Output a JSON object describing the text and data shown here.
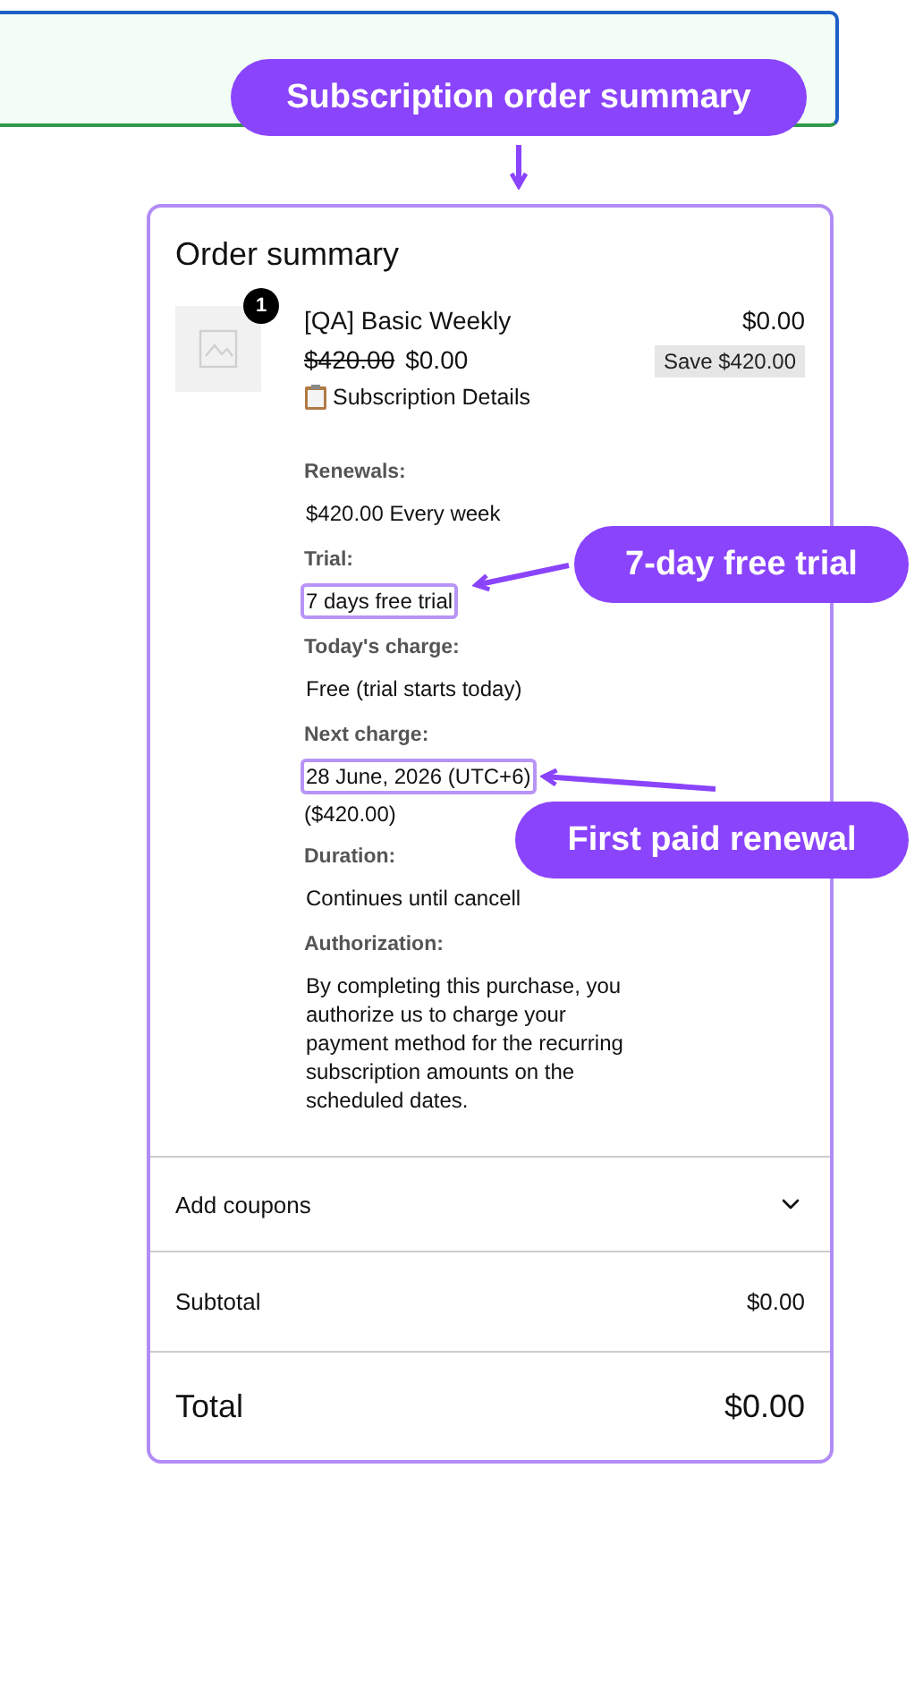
{
  "order_summary": {
    "title": "Order summary",
    "item": {
      "quantity": "1",
      "name": "[QA] Basic Weekly",
      "price": "$0.00",
      "original_price": "$420.00",
      "sale_price": "$0.00",
      "savings": "Save $420.00",
      "details_label": "Subscription Details"
    },
    "details": [
      {
        "label": "Renewals:",
        "value": "$420.00 Every week",
        "highlighted": false
      },
      {
        "label": "Trial:",
        "value": "7 days free trial",
        "highlighted": true
      },
      {
        "label": "Today's charge:",
        "value": "Free (trial starts today)",
        "highlighted": false
      },
      {
        "label": "Next charge:",
        "value": "28 June, 2026 (UTC+6)",
        "note": "($420.00)",
        "highlighted": true
      },
      {
        "label": "Duration:",
        "value": "Continues until cancell",
        "highlighted": false
      },
      {
        "label": "Authorization:",
        "highlighted": false,
        "value": "By completing this purchase, you authorize us to charge your payment method for the recurring subscription amounts on the scheduled dates."
      }
    ],
    "coupons": {
      "label": "Add coupons",
      "expanded": false
    },
    "subtotal": {
      "label": "Subtotal",
      "value": "$0.00"
    },
    "total": {
      "label": "Total",
      "value": "$0.00"
    }
  },
  "annotations": [
    {
      "text": "Subscription order summary"
    },
    {
      "text": "7-day free trial"
    },
    {
      "text": "First paid renewal"
    }
  ]
}
